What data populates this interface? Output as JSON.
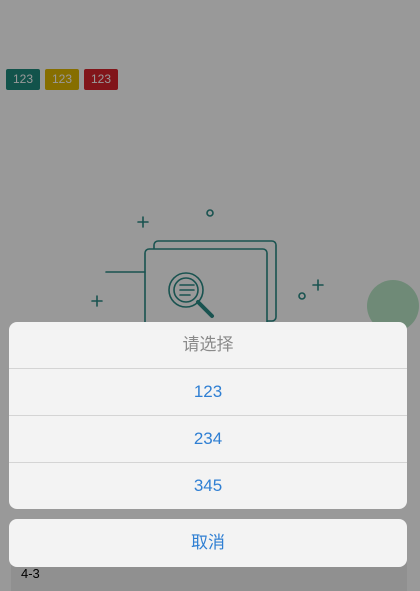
{
  "tags": [
    {
      "label": "123",
      "color": "#1e8a7e"
    },
    {
      "label": "123",
      "color": "#e0b800"
    },
    {
      "label": "123",
      "color": "#d8242c"
    }
  ],
  "colors": {
    "illustration_stroke": "#2a8a85",
    "fab": "#b9e7c7",
    "action_text": "#2f7fd3",
    "title_text": "#8a8a8a"
  },
  "illustration": {
    "icon": "empty-search-illustration"
  },
  "footer": {
    "text": "4-3"
  },
  "action_sheet": {
    "title": "请选择",
    "items": [
      {
        "label": "123"
      },
      {
        "label": "234"
      },
      {
        "label": "345"
      }
    ],
    "cancel_label": "取消"
  }
}
